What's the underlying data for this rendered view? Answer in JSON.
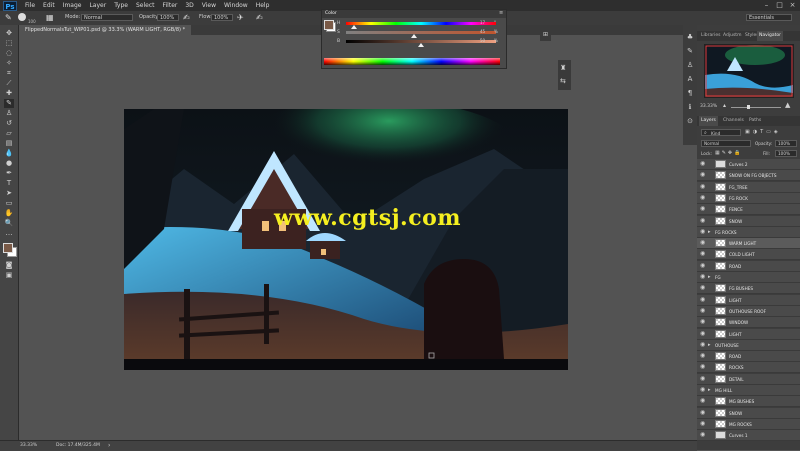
{
  "menubar": {
    "logo": "Ps",
    "items": [
      "File",
      "Edit",
      "Image",
      "Layer",
      "Type",
      "Select",
      "Filter",
      "3D",
      "View",
      "Window",
      "Help"
    ]
  },
  "options": {
    "brush_size": "100",
    "mode_label": "Mode:",
    "mode_value": "Normal",
    "opacity_label": "Opacity:",
    "opacity_value": "100%",
    "flow_label": "Flow:",
    "flow_value": "100%",
    "workspace": "Essentials"
  },
  "document": {
    "tab_title": "FlippedNormalsTut_WIP01.psd @ 33.3% (WARM LIGHT, RGB/8) *",
    "watermark": "www.cgtsj.com"
  },
  "status": {
    "zoom": "33.33%",
    "doc_size": "Doc: 17.4M/325.4M"
  },
  "color_panel": {
    "title": "Color",
    "channels": [
      {
        "label": "H",
        "value": "17",
        "unit": "°",
        "level": 0.05
      },
      {
        "label": "S",
        "value": "45",
        "unit": "%",
        "level": 0.45
      },
      {
        "label": "B",
        "value": "50",
        "unit": "%",
        "level": 0.5
      }
    ],
    "colors": {
      "foreground": "#7a5a47",
      "background": "#ffffff"
    }
  },
  "navigator": {
    "tabs": [
      "Libraries",
      "Adjustm",
      "Styles",
      "Navigator"
    ],
    "active_tab": "Navigator",
    "zoom": "33.33%"
  },
  "layers_panel": {
    "tabs": [
      "Layers",
      "Channels",
      "Paths"
    ],
    "active_tab": "Layers",
    "filter_label": "Kind",
    "blend_mode": "Normal",
    "opacity_label": "Opacity:",
    "opacity_value": "100%",
    "lock_label": "Lock:",
    "fill_label": "Fill:",
    "fill_value": "100%",
    "layers": [
      {
        "name": "Curves 2",
        "type": "adjust"
      },
      {
        "name": "SNOW ON FG OBJECTS",
        "type": "layer"
      },
      {
        "name": "FG_TREE",
        "type": "layer"
      },
      {
        "name": "FG ROCK",
        "type": "layer"
      },
      {
        "name": "FENCE",
        "type": "layer"
      },
      {
        "name": "SNOW",
        "type": "layer"
      },
      {
        "name": "FG ROCKS",
        "type": "group"
      },
      {
        "name": "WARM LIGHT",
        "type": "layer",
        "selected": true
      },
      {
        "name": "COLD LIGHT",
        "type": "layer"
      },
      {
        "name": "ROAD",
        "type": "layer"
      },
      {
        "name": "FG",
        "type": "group"
      },
      {
        "name": "FG BUSHES",
        "type": "layer"
      },
      {
        "name": "LIGHT",
        "type": "layer"
      },
      {
        "name": "OUTHOUSE ROOF",
        "type": "layer"
      },
      {
        "name": "WINDOW",
        "type": "layer"
      },
      {
        "name": "LIGHT",
        "type": "layer"
      },
      {
        "name": "OUTHOUSE",
        "type": "group"
      },
      {
        "name": "ROAD",
        "type": "layer"
      },
      {
        "name": "ROCKS",
        "type": "layer"
      },
      {
        "name": "DETAIL",
        "type": "layer"
      },
      {
        "name": "MG HILL",
        "type": "group"
      },
      {
        "name": "MG BUSHES",
        "type": "layer"
      },
      {
        "name": "SNOW",
        "type": "layer"
      },
      {
        "name": "MG ROCKS",
        "type": "layer"
      },
      {
        "name": "Curves 1",
        "type": "adjust"
      }
    ]
  }
}
